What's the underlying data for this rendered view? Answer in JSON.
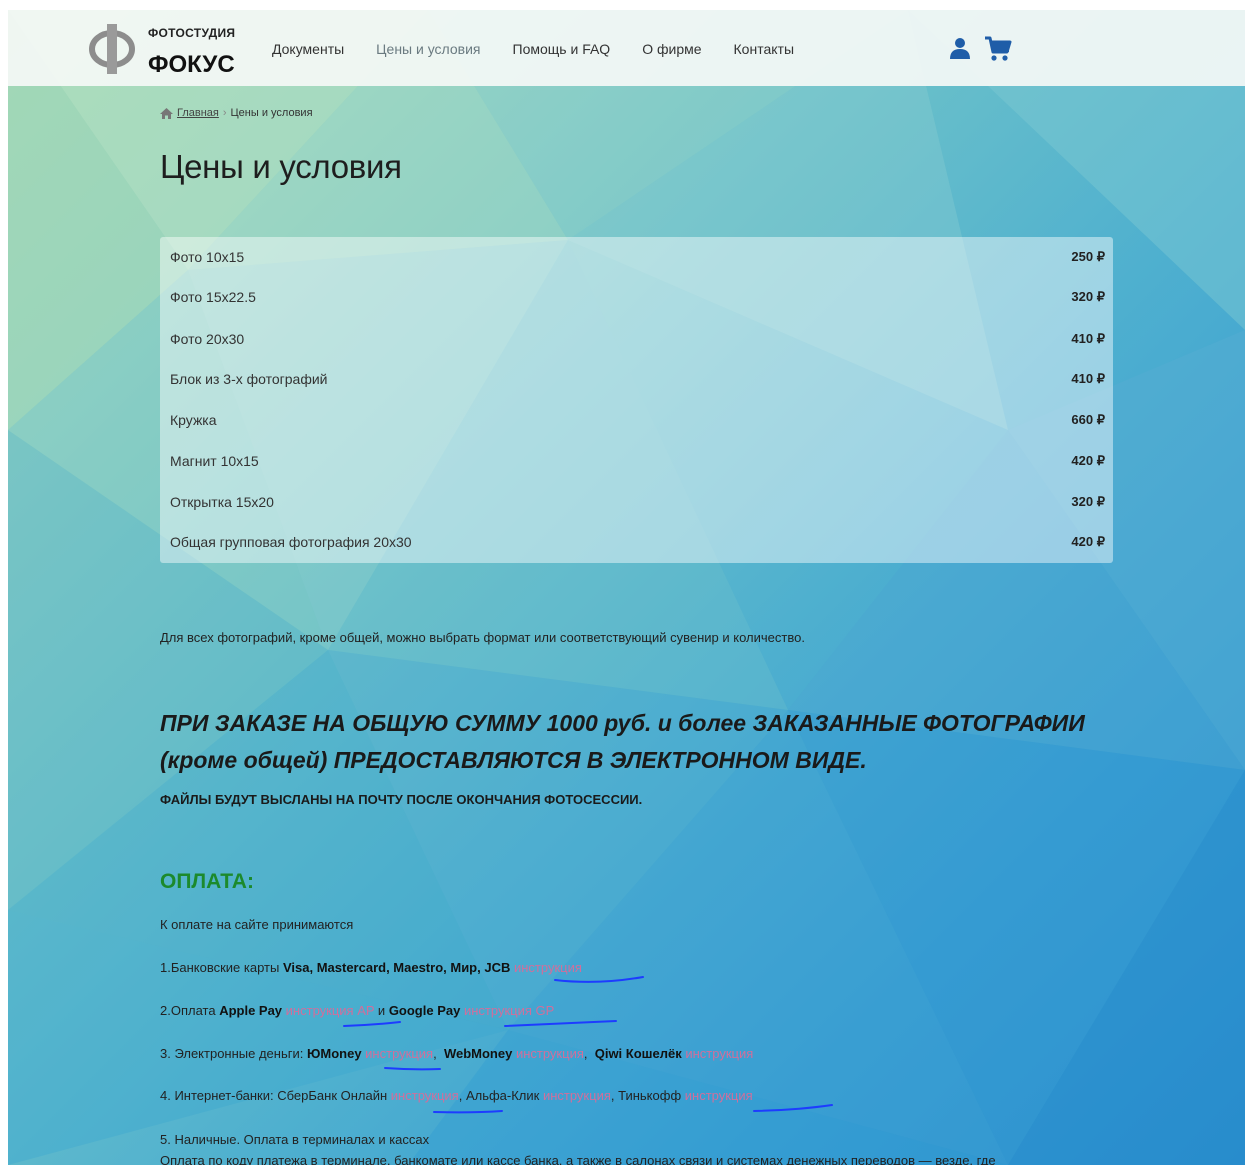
{
  "brand": {
    "small": "ФОТОСТУДИЯ",
    "big": "ФОКУС"
  },
  "nav": {
    "items": [
      {
        "label": "Документы"
      },
      {
        "label": "Цены и условия"
      },
      {
        "label": "Помощь и FAQ"
      },
      {
        "label": "О фирме"
      },
      {
        "label": "Контакты"
      }
    ]
  },
  "breadcrumb": {
    "home": "Главная",
    "sep": "›",
    "current": "Цены и условия"
  },
  "page_title": "Цены и условия",
  "prices": [
    {
      "name": "Фото 10х15",
      "price": "250 ₽"
    },
    {
      "name": "Фото 15х22.5",
      "price": "320 ₽"
    },
    {
      "name": "Фото 20х30",
      "price": "410 ₽"
    },
    {
      "name": "Блок из 3-х фотографий",
      "price": "410 ₽"
    },
    {
      "name": "Кружка",
      "price": "660 ₽"
    },
    {
      "name": "Магнит 10х15",
      "price": "420 ₽"
    },
    {
      "name": "Открытка 15х20",
      "price": "320 ₽"
    },
    {
      "name": "Общая групповая фотография 20х30",
      "price": "420 ₽"
    }
  ],
  "note": "Для всех фотографий, кроме общей, можно выбрать формат или соответствующий сувенир и количество.",
  "promo": "ПРИ ЗАКАЗЕ НА ОБЩУЮ СУММУ 1000 руб. и более ЗАКАЗАННЫЕ ФОТОГРАФИИ (кроме общей) ПРЕДОСТАВЛЯЮТСЯ В ЭЛЕКТРОННОМ ВИДЕ.",
  "files_note": "ФАЙЛЫ БУДУТ ВЫСЛАНЫ НА ПОЧТУ ПОСЛЕ ОКОНЧАНИЯ ФОТОСЕССИИ.",
  "payment": {
    "title": "ОПЛАТА:",
    "intro": "К оплате на сайте принимаются",
    "line1": {
      "prefix": "1.Банковские карты ",
      "bold": "Visa, Mastercard, Maestro, Мир, JCB",
      "link": "инструкция"
    },
    "line2": {
      "prefix": "2.Оплата ",
      "bold1": "Apple Pay",
      "link1": "инструкция AP",
      "mid": " и ",
      "bold2": "Google Pay",
      "link2": "инструкция GP"
    },
    "line3": {
      "prefix": "3. Электронные деньги: ",
      "b1": "ЮMoney",
      "l1": "инструкция",
      "b2": "WebMoney",
      "l2": "инструкция",
      "b3": "Qiwi Кошелёк",
      "l3": "инструкция"
    },
    "line4": {
      "prefix": "4. Интернет-банки: СберБанк Онлайн ",
      "l1": "инструкция",
      "mid1": ", Альфа-Клик ",
      "l2": "инструкция",
      "mid2": ", Тинькофф ",
      "l3": "инструкция"
    },
    "line5": "5. Наличные. Оплата в терминалах и кассах",
    "line6": "Оплата по коду платежа в терминале, банкомате или кассе банка, а также в салонах связи и системах денежных переводов — везде, где"
  },
  "colors": {
    "accent_green": "#1c8a2c",
    "link_pink": "#d06f9c",
    "cart_blue": "#1f5da8",
    "scribble_blue": "#1d3cff"
  }
}
